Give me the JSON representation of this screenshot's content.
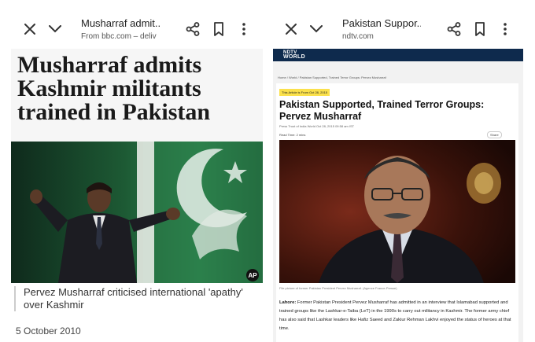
{
  "left": {
    "tab": {
      "title": "Musharraf admit...",
      "url": "From bbc.com – deliv"
    },
    "headline": "Musharraf admits Kashmir militants trained in Pakistan",
    "image_badge": "AP",
    "caption": "Pervez Musharraf criticised international 'apathy' over Kashmir",
    "date": "5 October 2010"
  },
  "right": {
    "tab": {
      "title": "Pakistan Suppor...",
      "url": "ndtv.com"
    },
    "logo_top": "NDTV",
    "logo_bottom": "WORLD",
    "breadcrumb": "Home / World / Pakistan Supported, Trained Terror Groups: Pervez Musharraf",
    "tag": "This Article is From Oct 28, 2015",
    "headline": "Pakistan Supported, Trained Terror Groups: Pervez Musharraf",
    "meta": "Press Trust of India   World   Oct 28, 2015 09:58 am IST",
    "read_time": "Read Time: 2 mins",
    "share": "Share",
    "image_caption": "File picture of former Pakistan President Pervez Musharraf. (Agence France-Presse)",
    "body_lead": "Lahore:",
    "body": " Former Pakistan President Pervez Musharraf has admitted in an interview that Islamabad supported and trained groups like the Lashkar-e-Taiba (LeT) in the 1990s to carry out militancy in Kashmir. The former army chief has also said that Lashkar leaders like Hafiz Saeed and Zakiur Rehman Lakhvi enjoyed the status of heroes at that time."
  },
  "icons": [
    "close-icon",
    "chevron-down-icon",
    "share-icon",
    "bookmark-icon",
    "more-vert-icon"
  ],
  "colors": {
    "ndtv_header": "#0e2a4d",
    "tag_yellow": "#fbe14c",
    "bbc_headline_bg": "#f6f6f6"
  }
}
